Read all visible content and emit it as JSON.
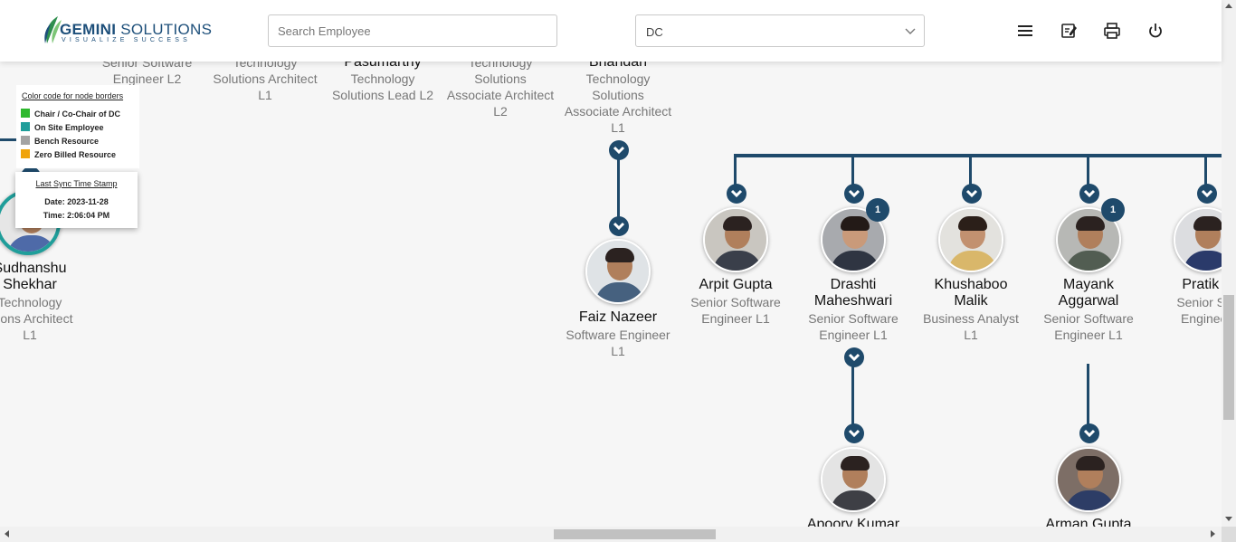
{
  "header": {
    "logo": {
      "brand": "GEMINI",
      "brand2": "SOLUTIONS",
      "tagline": "VISUALIZE SUCCESS"
    },
    "search": {
      "placeholder": "Search Employee",
      "value": ""
    },
    "dc_select": {
      "value": "DC"
    },
    "icons": [
      "menu-icon",
      "edit-note-icon",
      "print-icon",
      "power-icon"
    ]
  },
  "legend": {
    "title": "Color code for node borders",
    "items": [
      {
        "label": "Chair / Co-Chair of DC",
        "color": "#2db82d"
      },
      {
        "label": "On Site Employee",
        "color": "#1f9e9a"
      },
      {
        "label": "Bench Resource",
        "color": "#a3a3a3"
      },
      {
        "label": "Zero Billed Resource",
        "color": "#f0a30a"
      }
    ]
  },
  "sync": {
    "title": "Last Sync Time Stamp",
    "date_label": "Date:",
    "date": "2023-11-28",
    "time_label": "Time:",
    "time": "2:06:04 PM"
  },
  "top_nodes": [
    {
      "role_lines": [
        "Senior Software",
        "Engineer L2"
      ]
    },
    {
      "role_lines": [
        "Technology",
        "Solutions Architect",
        "L1"
      ]
    },
    {
      "name": "Pasumarthy",
      "role_lines": [
        "Technology",
        "Solutions Lead L2"
      ]
    },
    {
      "role_lines": [
        "Technology",
        "Solutions",
        "Associate Architect",
        "L2"
      ]
    },
    {
      "name": "Bhandari",
      "role_lines": [
        "Technology",
        "Solutions",
        "Associate Architect",
        "L1"
      ]
    }
  ],
  "left_node": {
    "name_lines": [
      "Sudhanshu",
      "Shekhar"
    ],
    "role_lines": [
      "Technology",
      "utions Architect",
      "L1"
    ]
  },
  "nodes": [
    {
      "name": "Faiz Nazeer",
      "role_lines": [
        "Software Engineer",
        "L1"
      ]
    },
    {
      "name": "Arpit Gupta",
      "role_lines": [
        "Senior Software",
        "Engineer L1"
      ]
    },
    {
      "name_lines": [
        "Drashti",
        "Maheshwari"
      ],
      "role_lines": [
        "Senior Software",
        "Engineer L1"
      ],
      "badge": "1"
    },
    {
      "name_lines": [
        "Khushaboo",
        "Malik"
      ],
      "role_lines": [
        "Business Analyst",
        "L1"
      ]
    },
    {
      "name_lines": [
        "Mayank",
        "Aggarwal"
      ],
      "role_lines": [
        "Senior Software",
        "Engineer L1"
      ],
      "badge": "1"
    },
    {
      "name": "Pratik J",
      "role_lines": [
        "Senior Sof",
        "Engineer"
      ]
    },
    {
      "name": "Apoorv Kumar"
    },
    {
      "name": "Arman Gupta"
    }
  ]
}
